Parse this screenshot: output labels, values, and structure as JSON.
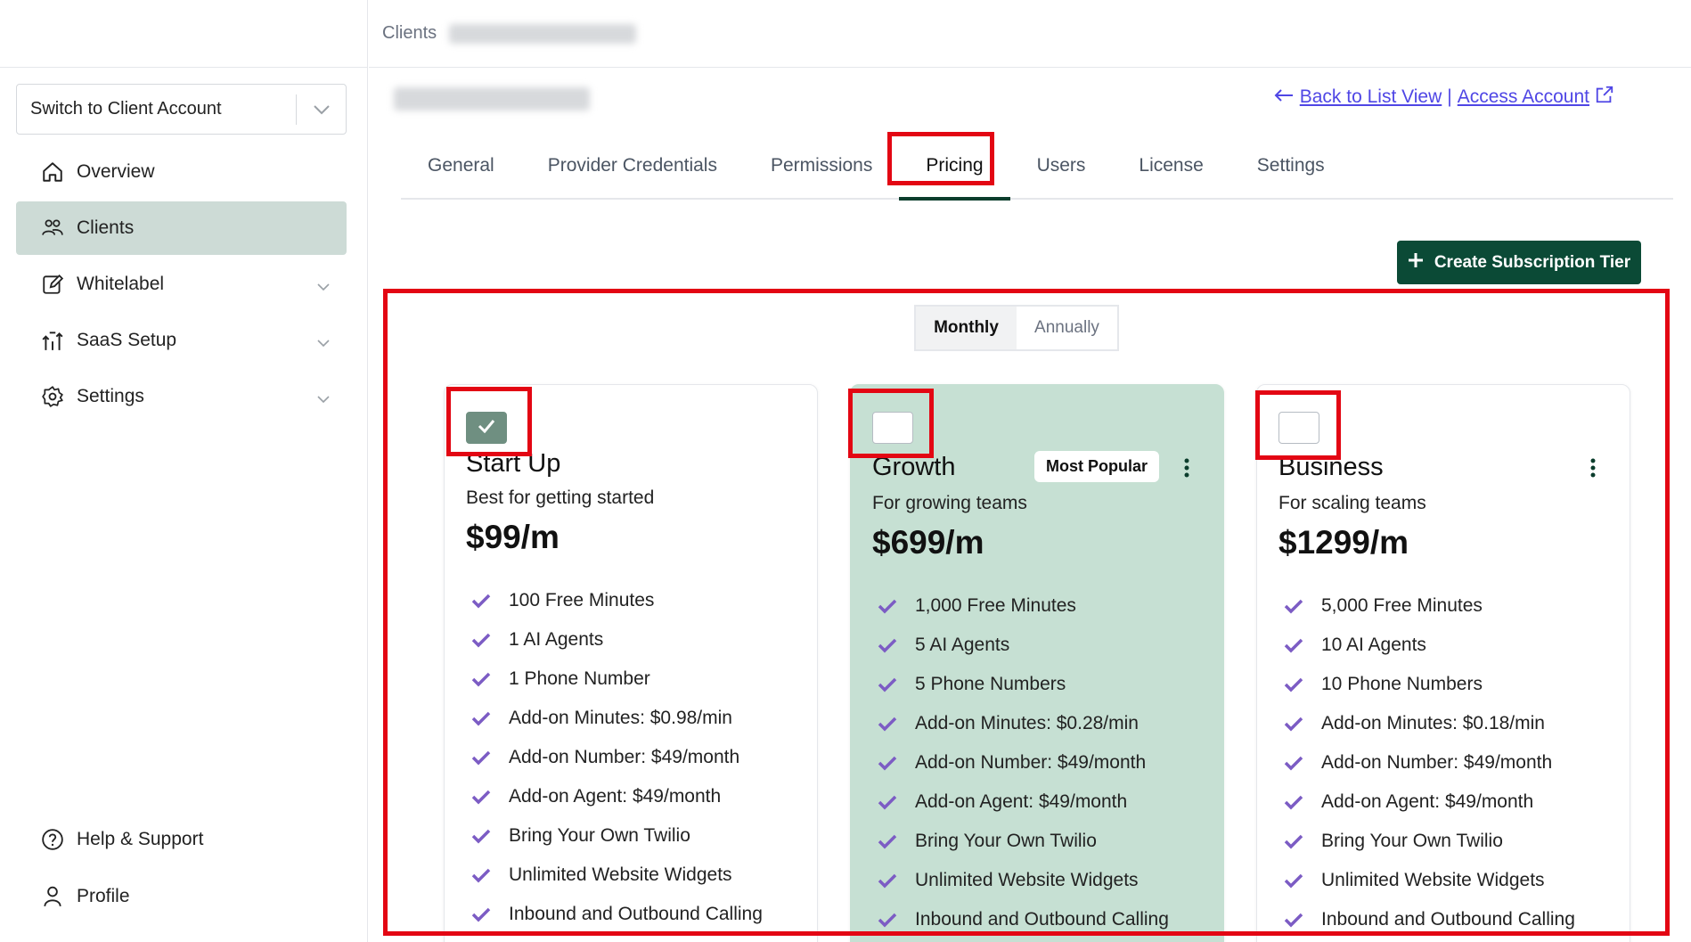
{
  "sidebar": {
    "switch_account": "Switch to Client Account",
    "items": [
      {
        "label": "Overview",
        "icon": "home-icon"
      },
      {
        "label": "Clients",
        "icon": "users-icon",
        "active": true
      },
      {
        "label": "Whitelabel",
        "icon": "edit-icon",
        "expandable": true
      },
      {
        "label": "SaaS Setup",
        "icon": "saas-icon",
        "expandable": true
      },
      {
        "label": "Settings",
        "icon": "gear-icon",
        "expandable": true
      }
    ],
    "bottom": [
      {
        "label": "Help & Support",
        "icon": "help-icon"
      },
      {
        "label": "Profile",
        "icon": "user-icon"
      }
    ]
  },
  "header": {
    "breadcrumb_root": "Clients"
  },
  "links": {
    "back": "Back to List View",
    "separator": "|",
    "access": "Access Account"
  },
  "tabs": [
    "General",
    "Provider Credentials",
    "Permissions",
    "Pricing",
    "Users",
    "License",
    "Settings"
  ],
  "active_tab": "Pricing",
  "create_button": "Create Subscription Tier",
  "billing_toggle": {
    "monthly": "Monthly",
    "annually": "Annually",
    "selected": "Monthly"
  },
  "plans": [
    {
      "name": "Start Up",
      "subtitle": "Best for getting started",
      "price": "$99/m",
      "selected": true,
      "features": [
        "100 Free Minutes",
        "1 AI Agents",
        "1 Phone Number",
        "Add-on Minutes: $0.98/min",
        "Add-on Number: $49/month",
        "Add-on Agent: $49/month",
        "Bring Your Own Twilio",
        "Unlimited Website Widgets",
        "Inbound and Outbound Calling"
      ]
    },
    {
      "name": "Growth",
      "subtitle": "For growing teams",
      "price": "$699/m",
      "selected": false,
      "badge": "Most Popular",
      "features": [
        "1,000 Free Minutes",
        "5 AI Agents",
        "5 Phone Numbers",
        "Add-on Minutes: $0.28/min",
        "Add-on Number: $49/month",
        "Add-on Agent: $49/month",
        "Bring Your Own Twilio",
        "Unlimited Website Widgets",
        "Inbound and Outbound Calling"
      ]
    },
    {
      "name": "Business",
      "subtitle": "For scaling teams",
      "price": "$1299/m",
      "selected": false,
      "features": [
        "5,000 Free Minutes",
        "10 AI Agents",
        "10 Phone Numbers",
        "Add-on Minutes: $0.18/min",
        "Add-on Number: $49/month",
        "Add-on Agent: $49/month",
        "Bring Your Own Twilio",
        "Unlimited Website Widgets",
        "Inbound and Outbound Calling"
      ]
    }
  ],
  "colors": {
    "accent_dark_green": "#0b4a36",
    "active_nav_bg": "#cddbd6",
    "popular_card_bg": "#c6e0d3",
    "link": "#4f46e5",
    "check_purple": "#7c5cc4",
    "highlight_red": "#e30613"
  }
}
